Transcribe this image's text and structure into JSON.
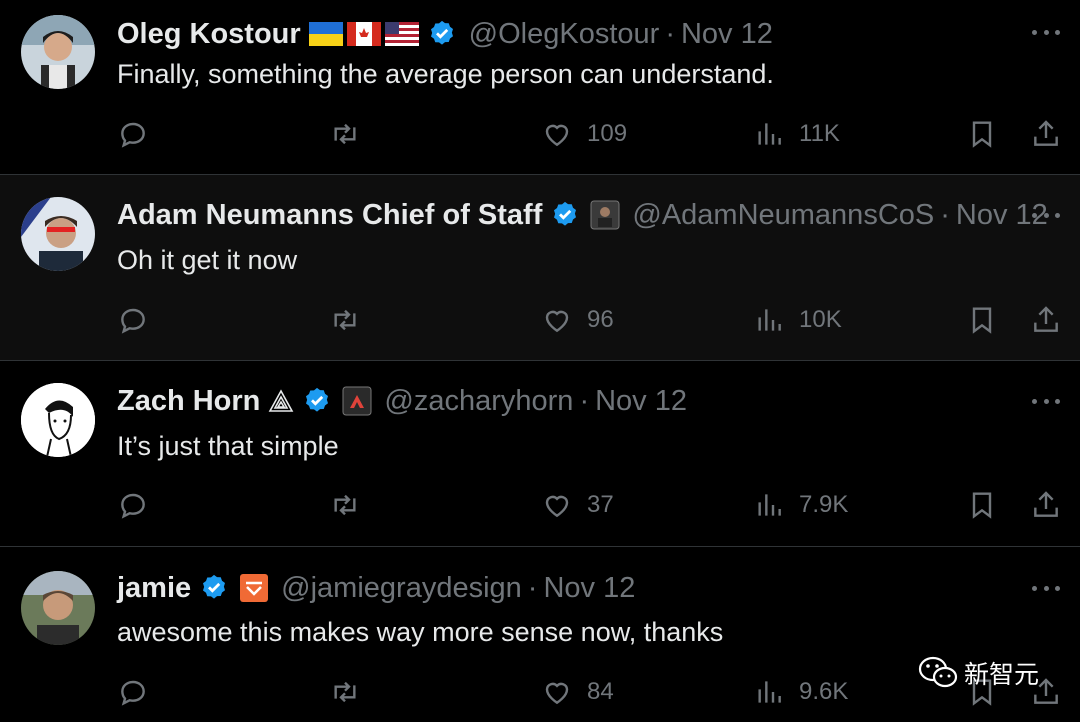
{
  "tweets": [
    {
      "name": "Oleg Kostour",
      "handle": "@OlegKostour",
      "sep": "·",
      "date": "Nov 12",
      "text": "Finally, something the average person can understand.",
      "likes": "109",
      "views": "11K"
    },
    {
      "name": "Adam Neumanns Chief of Staff",
      "handle": "@AdamNeumannsCoS",
      "sep": "·",
      "date": "Nov 12",
      "text": "Oh it get it now",
      "likes": "96",
      "views": "10K"
    },
    {
      "name": "Zach Horn",
      "handle": "@zacharyhorn",
      "sep": "·",
      "date": "Nov 12",
      "text": "It’s just that simple",
      "likes": "37",
      "views": "7.9K"
    },
    {
      "name": "jamie",
      "handle": "@jamiegraydesign",
      "sep": "·",
      "date": "Nov 12",
      "text": "awesome this makes way more sense now, thanks",
      "likes": "84",
      "views": "9.6K"
    }
  ],
  "watermark": "新智元",
  "colors": {
    "verified": "#1d9bf0",
    "muted": "#71767b",
    "text": "#e7e9ea"
  },
  "icons": [
    "reply-icon",
    "retweet-icon",
    "like-icon",
    "views-icon",
    "bookmark-icon",
    "share-icon",
    "more-icon",
    "verified-icon"
  ]
}
